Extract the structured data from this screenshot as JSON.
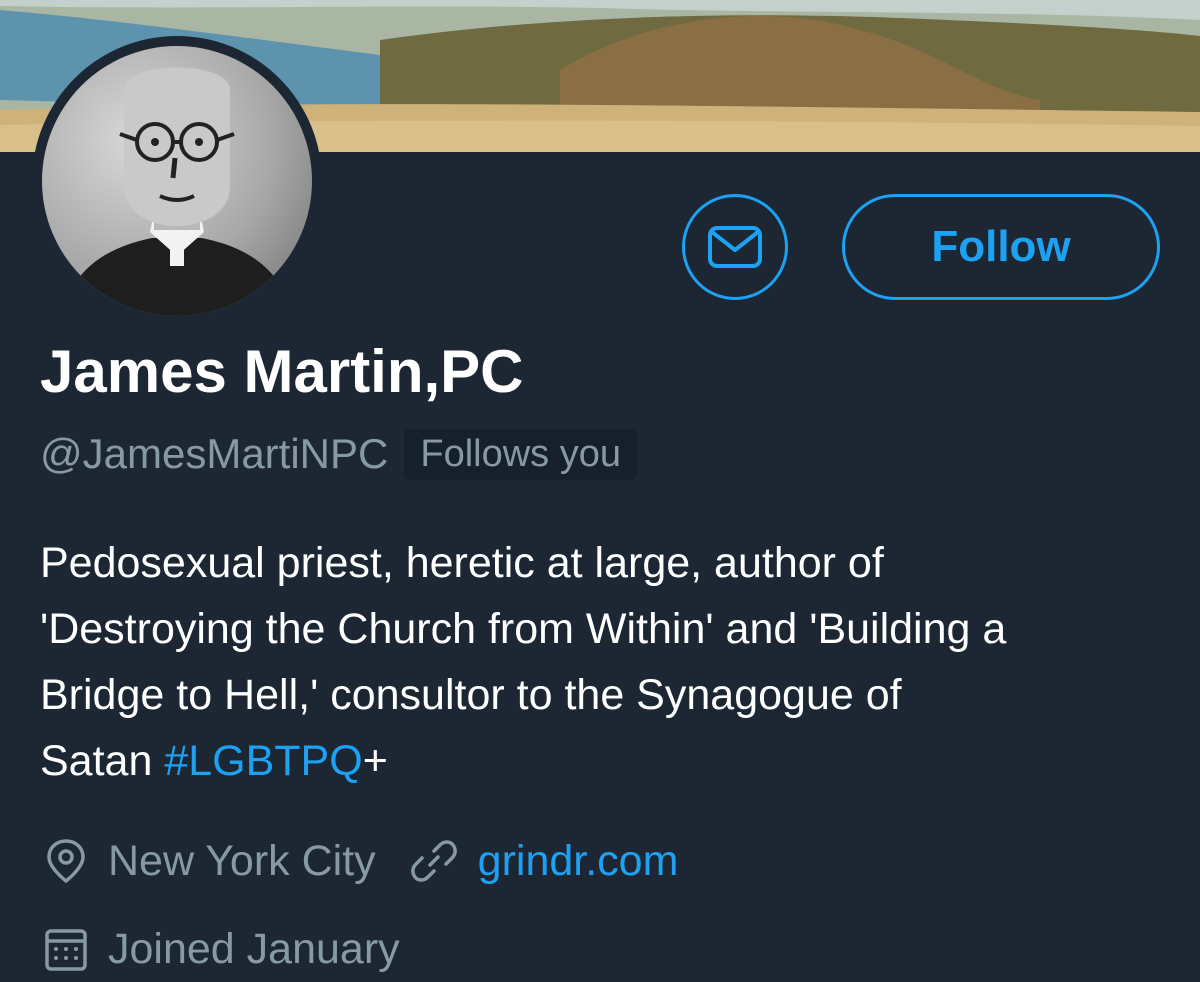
{
  "profile": {
    "display_name": "James Martin,PC",
    "handle": "@JamesMartiNPC",
    "follows_you_badge": "Follows you",
    "bio": {
      "line1": "Pedosexual priest, heretic at large, author of",
      "line2": "'Destroying the Church from Within' and 'Building a",
      "line3": "Bridge to Hell,' consultor to the Synagogue of",
      "line4_prefix": "Satan ",
      "hashtag": "#LGBTPQ",
      "line4_suffix": "+"
    },
    "location": "New York City",
    "website": "grindr.com",
    "joined": "Joined January"
  },
  "actions": {
    "follow_label": "Follow",
    "message_icon": "envelope-icon"
  },
  "icons": {
    "location": "map-pin-icon",
    "website": "link-icon",
    "joined": "calendar-icon"
  },
  "colors": {
    "background": "#1c2733",
    "accent": "#1da1f2",
    "secondary_text": "#8899a6",
    "primary_text": "#ffffff"
  }
}
